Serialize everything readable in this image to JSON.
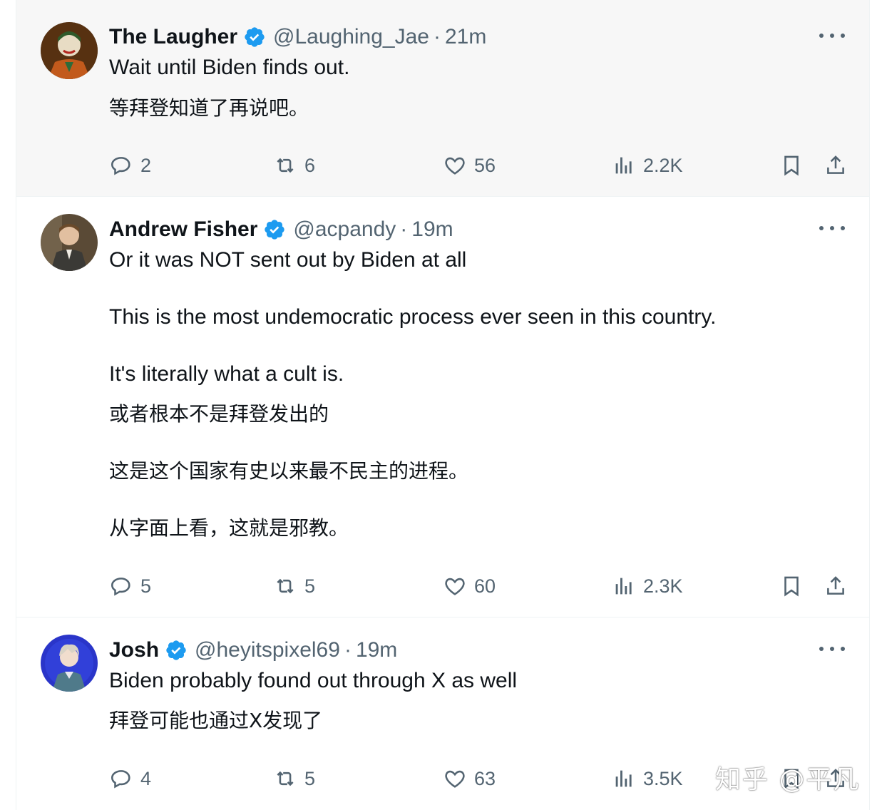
{
  "colors": {
    "verified": "#1d9bf0",
    "muted": "#536471",
    "highlight_bg": "#f7f7f7"
  },
  "tweets": [
    {
      "name": "The Laugher",
      "handle": "@Laughing_Jae",
      "dot": "·",
      "time": "21m",
      "lines": [
        "Wait until Biden finds out.",
        "等拜登知道了再说吧。"
      ],
      "replies": "2",
      "reposts": "6",
      "likes": "56",
      "views": "2.2K",
      "icons": [
        "reply-icon",
        "repost-icon",
        "like-icon",
        "views-icon",
        "bookmark-icon",
        "share-icon"
      ]
    },
    {
      "name": "Andrew Fisher",
      "handle": "@acpandy",
      "dot": "·",
      "time": "19m",
      "lines": [
        "Or it was NOT sent out by Biden at all",
        "This is the most undemocratic process ever seen in this country.",
        "It's literally what a cult is.",
        "或者根本不是拜登发出的",
        "这是这个国家有史以来最不民主的进程。",
        "从字面上看，这就是邪教。"
      ],
      "replies": "5",
      "reposts": "5",
      "likes": "60",
      "views": "2.3K"
    },
    {
      "name": "Josh",
      "handle": "@heyitspixel69",
      "dot": "·",
      "time": "19m",
      "lines": [
        "Biden probably found out through X as well",
        "拜登可能也通过X发现了"
      ],
      "replies": "4",
      "reposts": "5",
      "likes": "63",
      "views": "3.5K"
    }
  ],
  "watermark": "知乎 @平凡"
}
